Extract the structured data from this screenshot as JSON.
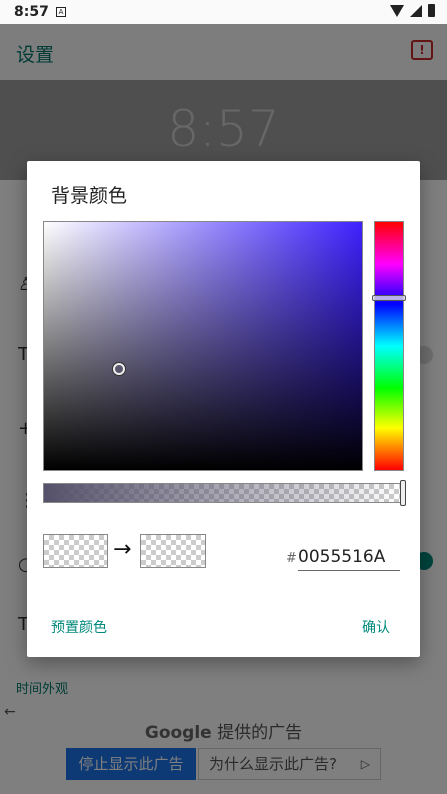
{
  "status_bar": {
    "time": "8:57",
    "notif_glyph": "A"
  },
  "app_bar": {
    "title": "设置"
  },
  "preview": {
    "clock": "8:57"
  },
  "settings": {
    "section_title": "时间外观"
  },
  "ad": {
    "google": "Google",
    "title_suffix": "提供的广告",
    "stop_label": "停止显示此广告",
    "why_label": "为什么显示此广告?",
    "play_glyph": "▷"
  },
  "dialog": {
    "title": "背景颜色",
    "hash": "#",
    "hex_value": "0055516A",
    "presets_label": "预置颜色",
    "confirm_label": "确认",
    "arrow_glyph": "→"
  },
  "colors": {
    "accent": "#00897b",
    "title_teal": "#00796b",
    "hue": "#3e22ff",
    "selected_color": "#55516a"
  }
}
